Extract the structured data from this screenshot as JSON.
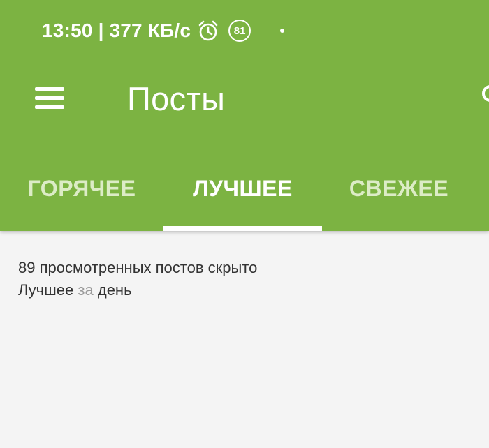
{
  "status_bar": {
    "time": "13:50",
    "separator": "|",
    "network_speed": "377 КБ/с",
    "battery_level": "81",
    "icons": [
      "alarm-icon",
      "battery-badge",
      "dot-icon"
    ]
  },
  "toolbar": {
    "title": "Посты",
    "menu_icon": "menu-icon",
    "search_icon": "search-icon"
  },
  "tabs": [
    {
      "label": "ГОРЯЧЕЕ",
      "active": false
    },
    {
      "label": "ЛУЧШЕЕ",
      "active": true
    },
    {
      "label": "СВЕЖЕЕ",
      "active": false
    }
  ],
  "content": {
    "hidden_posts_text": "89 просмотренных постов скрыто",
    "period_prefix": "Лучшее",
    "period_connector": "за",
    "period_value": "день"
  },
  "colors": {
    "app_bar": "#7cb342",
    "background": "#f4f4f4",
    "active_tab": "#ffffff",
    "inactive_tab": "#dcecc6",
    "text": "#333333",
    "muted_text": "#9a9a9a"
  }
}
